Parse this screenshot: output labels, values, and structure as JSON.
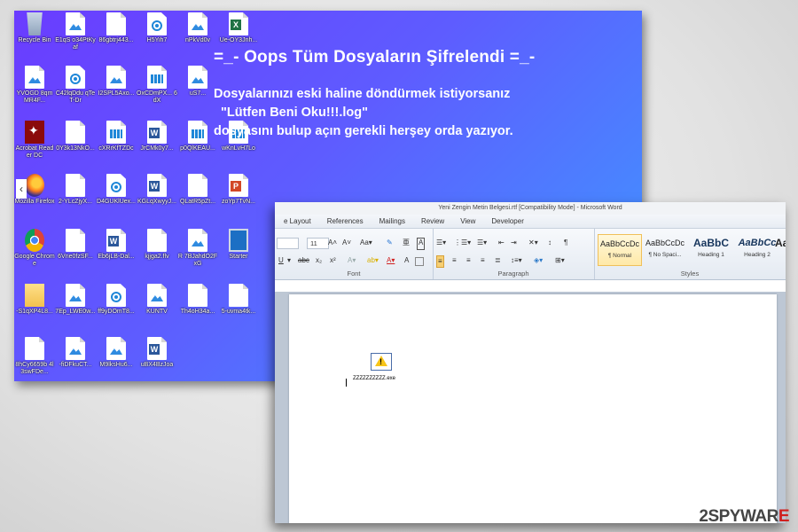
{
  "desktop": {
    "message": {
      "title": "=_- Oops Tüm Dosyaların Şifrelendi =_-",
      "line1": "Dosyalarınızı eski haline döndürmek istiyorsanız",
      "line2": "\"Lütfen Beni Oku!!!.log\"",
      "line3": "dosyasını bulup açın gerekli herşey orda yazıyor."
    },
    "icons": [
      {
        "label": "Recycle Bin",
        "kind": "bin"
      },
      {
        "label": "E1qS o34PtKyaf",
        "kind": "img"
      },
      {
        "label": "86gbtrj443...",
        "kind": "doc"
      },
      {
        "label": "H5Yih7",
        "kind": "media"
      },
      {
        "label": "nPkVd0v",
        "kind": "img"
      },
      {
        "label": "Ue-OY3Jnh...",
        "kind": "excel"
      },
      {
        "label": "YVOGD 8qmMR4F...",
        "kind": "img"
      },
      {
        "label": "C42lqDdu qTeT-Dr",
        "kind": "media"
      },
      {
        "label": "I2SPL5Axo...",
        "kind": "img"
      },
      {
        "label": "OxCDmPX... 6dX",
        "kind": "film"
      },
      {
        "label": "uS7...",
        "kind": "img"
      },
      {
        "label": "Acrobat Reader DC",
        "kind": "acrobat"
      },
      {
        "label": "0Y3k13NkO...",
        "kind": "doc"
      },
      {
        "label": "cXRrKfTZDc",
        "kind": "film"
      },
      {
        "label": "JrCMk0y7...",
        "kind": "word"
      },
      {
        "label": "p0QlKEAU...",
        "kind": "film"
      },
      {
        "label": "wKnLvH7Lo",
        "kind": "film"
      },
      {
        "label": "Mozilla Firefox",
        "kind": "firefox"
      },
      {
        "label": "2-YLcZjyX...",
        "kind": "doc"
      },
      {
        "label": "D4GUKlUex...",
        "kind": "media"
      },
      {
        "label": "KGLqXwyyJ...",
        "kind": "word"
      },
      {
        "label": "QLatR5pZt...",
        "kind": "doc"
      },
      {
        "label": "zoYp7TvN...",
        "kind": "ppt"
      },
      {
        "label": "Google Chrome",
        "kind": "chrome"
      },
      {
        "label": "6Vne0fzSF...",
        "kind": "doc"
      },
      {
        "label": "Eb6jLB-Dal...",
        "kind": "word"
      },
      {
        "label": "kjjga2.flv",
        "kind": "doc"
      },
      {
        "label": "R 7BJahdO2FxG",
        "kind": "img"
      },
      {
        "label": "Starter",
        "kind": "monitor"
      },
      {
        "label": "-S1qXP4L8...",
        "kind": "folder"
      },
      {
        "label": "7Ep_LWE0w...",
        "kind": "img"
      },
      {
        "label": "ff9yDOmT8...",
        "kind": "media"
      },
      {
        "label": "KUNTV",
        "kind": "img"
      },
      {
        "label": "Th4oH34a...",
        "kind": "doc"
      },
      {
        "label": "5-uvma4tk...",
        "kind": "doc"
      },
      {
        "label": "8hCy6659b 4l3swFDe...",
        "kind": "doc"
      },
      {
        "label": "-fiDFkuCT...",
        "kind": "img"
      },
      {
        "label": "M9lksHu6...",
        "kind": "img"
      },
      {
        "label": "uBX4BzJoa",
        "kind": "word"
      }
    ]
  },
  "word": {
    "title": "Yeni Zengin Metin Belgesi.rtf [Compatibility Mode] - Microsoft Word",
    "menu": [
      "e Layout",
      "References",
      "Mailings",
      "Review",
      "View",
      "Developer"
    ],
    "ribbon": {
      "font_size": "11",
      "group_font": "Font",
      "group_paragraph": "Paragraph",
      "group_styles": "Styles",
      "styles": [
        {
          "preview": "AaBbCcDc",
          "name": "¶ Normal"
        },
        {
          "preview": "AaBbCcDc",
          "name": "¶ No Spaci..."
        },
        {
          "preview": "AaBbC",
          "name": "Heading 1"
        },
        {
          "preview": "AaBbCc",
          "name": "Heading 2"
        },
        {
          "preview": "Aa",
          "name": ""
        }
      ]
    },
    "document": {
      "attachment_name": "ZZZZZZZZZZ.exe"
    }
  },
  "watermark": {
    "num": "2",
    "text": "SPYWAR",
    "suffix": "E"
  },
  "colors": {
    "desktop_from": "#6a3cff",
    "desktop_to": "#3d9cff",
    "word_blue": "#2b579a"
  }
}
